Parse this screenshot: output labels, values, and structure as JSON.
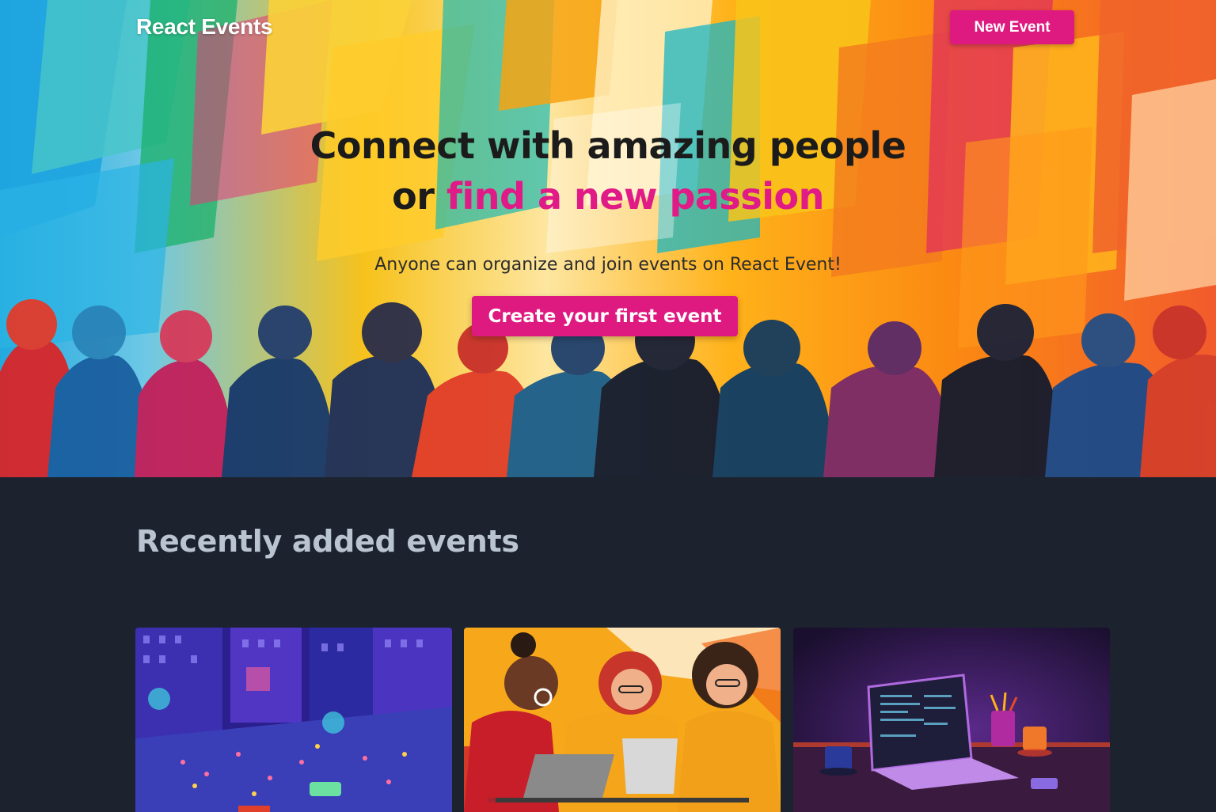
{
  "nav": {
    "logo": "React Events",
    "new_event_label": "New Event"
  },
  "hero": {
    "title_line1": "Connect with amazing people",
    "title_line2_prefix": "or ",
    "title_line2_accent": "find a new passion",
    "subtitle": "Anyone can organize and join events on React Event!",
    "cta_label": "Create your first event"
  },
  "recent": {
    "heading": "Recently added events",
    "cards": [
      {
        "image": "night-city-crowd-illustration"
      },
      {
        "image": "women-with-laptops-illustration"
      },
      {
        "image": "laptop-on-desk-illustration"
      }
    ]
  },
  "colors": {
    "accent": "#de1a80",
    "background": "#1c232e",
    "heading": "#b9c4d0"
  }
}
